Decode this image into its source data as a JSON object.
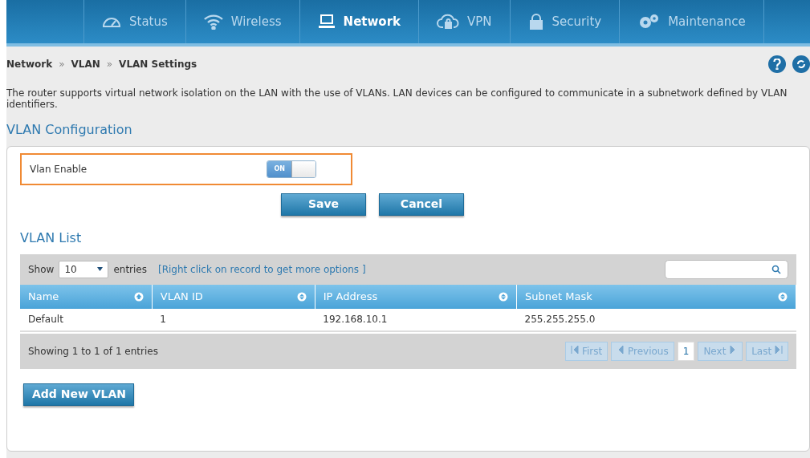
{
  "nav": [
    {
      "label": "Status",
      "selected": false
    },
    {
      "label": "Wireless",
      "selected": false
    },
    {
      "label": "Network",
      "selected": true
    },
    {
      "label": "VPN",
      "selected": false
    },
    {
      "label": "Security",
      "selected": false
    },
    {
      "label": "Maintenance",
      "selected": false
    }
  ],
  "breadcrumb": [
    "Network",
    "»",
    "VLAN",
    "»",
    "VLAN Settings"
  ],
  "description": "The router supports virtual network isolation on the LAN with the use of VLANs. LAN devices can be configured to communicate in a subnetwork defined by VLAN identifiers.",
  "section_title": "VLAN Configuration",
  "vlan_enable": {
    "label": "Vlan Enable",
    "on": true,
    "state_text": "ON"
  },
  "buttons": [
    "Save",
    "Cancel"
  ],
  "list_title": "VLAN List",
  "table_toolbar": {
    "show_label": "Show",
    "page_size": "10",
    "entries_label": "entries",
    "hint": "[Right click on record to get more options ]"
  },
  "table": {
    "columns": [
      {
        "label": "Name",
        "sorted": true
      },
      {
        "label": "VLAN ID",
        "sorted": false
      },
      {
        "label": "IP Address",
        "sorted": false
      },
      {
        "label": "Subnet Mask",
        "sorted": false
      }
    ],
    "rows": [
      [
        "Default",
        "1",
        "192.168.10.1",
        "255.255.255.0"
      ]
    ]
  },
  "footer_info": "Showing 1 to 1 of 1 entries",
  "pagination": [
    {
      "label": "First",
      "kind": "first",
      "disabled": true,
      "selected": false
    },
    {
      "label": "Previous",
      "kind": "prev",
      "disabled": true,
      "selected": false
    },
    {
      "label": "1",
      "kind": "page",
      "disabled": false,
      "selected": true
    },
    {
      "label": "Next",
      "kind": "next",
      "disabled": true,
      "selected": false
    },
    {
      "label": "Last",
      "kind": "last",
      "disabled": true,
      "selected": false
    }
  ],
  "add_button": "Add New VLAN"
}
